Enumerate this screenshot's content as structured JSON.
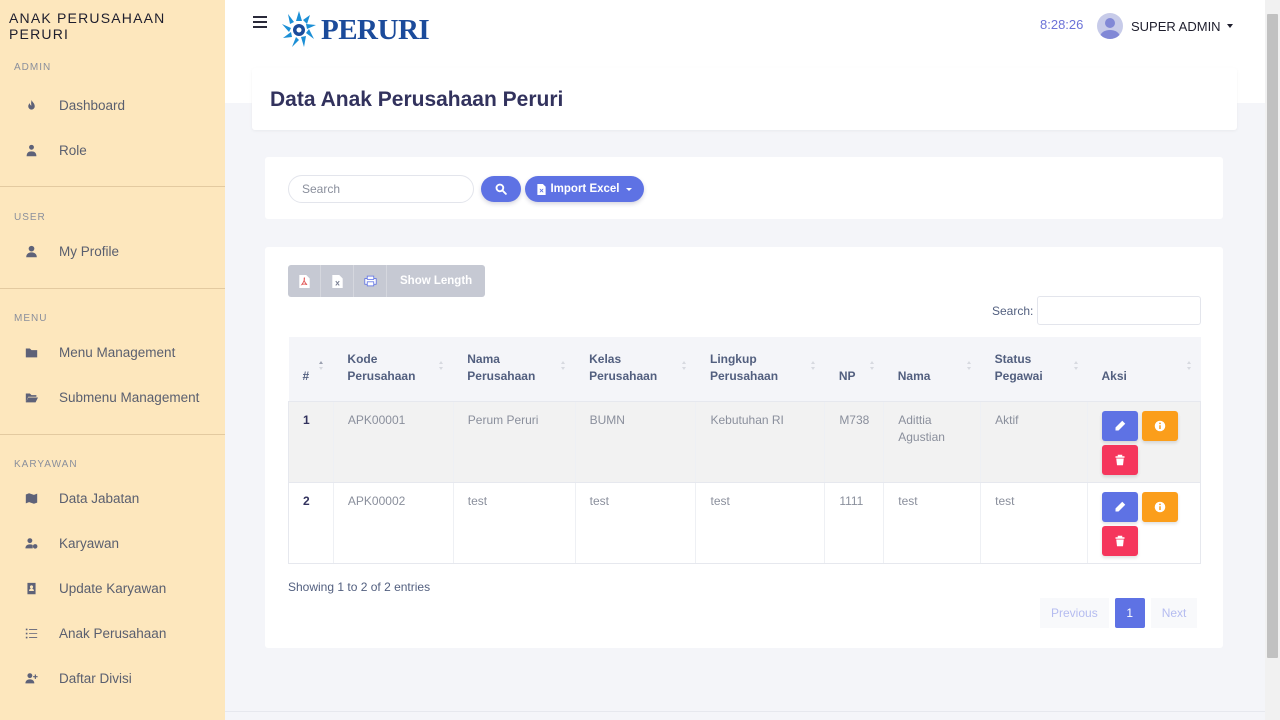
{
  "sidebar": {
    "brand": "ANAK PERUSAHAAN PERURI",
    "sections": [
      {
        "label": "ADMIN",
        "items": [
          {
            "label": "Dashboard",
            "icon": "fire-icon"
          },
          {
            "label": "Role",
            "icon": "user-tie-icon"
          }
        ]
      },
      {
        "label": "USER",
        "items": [
          {
            "label": "My Profile",
            "icon": "user-icon"
          }
        ]
      },
      {
        "label": "MENU",
        "items": [
          {
            "label": "Menu Management",
            "icon": "folder-icon"
          },
          {
            "label": "Submenu Management",
            "icon": "folder-open-icon"
          }
        ]
      },
      {
        "label": "KARYAWAN",
        "items": [
          {
            "label": "Data Jabatan",
            "icon": "map-icon"
          },
          {
            "label": "Karyawan",
            "icon": "user-cog-icon"
          },
          {
            "label": "Update Karyawan",
            "icon": "address-book-icon"
          },
          {
            "label": "Anak Perusahaan",
            "icon": "list-icon"
          },
          {
            "label": "Daftar Divisi",
            "icon": "user-plus-icon"
          }
        ]
      }
    ]
  },
  "header": {
    "logo_text": "PERURI",
    "clock": "8:28:26",
    "user_name": "SUPER ADMIN"
  },
  "page": {
    "title": "Data Anak Perusahaan Peruri"
  },
  "toolbar": {
    "search_placeholder": "Search",
    "import_label": "Import Excel"
  },
  "datatable": {
    "export_buttons": [
      "pdf-icon",
      "excel-icon",
      "print-icon"
    ],
    "show_length_label": "Show Length",
    "search_label": "Search:",
    "columns": [
      "#",
      "Kode Perusahaan",
      "Nama Perusahaan",
      "Kelas Perusahaan",
      "Lingkup Perusahaan",
      "NP",
      "Nama",
      "Status Pegawai",
      "Aksi"
    ],
    "rows": [
      [
        "1",
        "APK00001",
        "Perum Peruri",
        "BUMN",
        "Kebutuhan RI",
        "M738",
        "Adittia Agustian",
        "Aktif"
      ],
      [
        "2",
        "APK00002",
        "test",
        "test",
        "test",
        "1111",
        "test",
        "test"
      ]
    ],
    "info": "Showing 1 to 2 of 2 entries",
    "pagination": {
      "previous": "Previous",
      "current": "1",
      "next": "Next"
    }
  },
  "colors": {
    "sidebar_bg": "#fde7bd",
    "primary": "#5e72e4",
    "warning": "#fb9e1b",
    "danger": "#f5365c",
    "logo_blue": "#1b4b9b"
  }
}
